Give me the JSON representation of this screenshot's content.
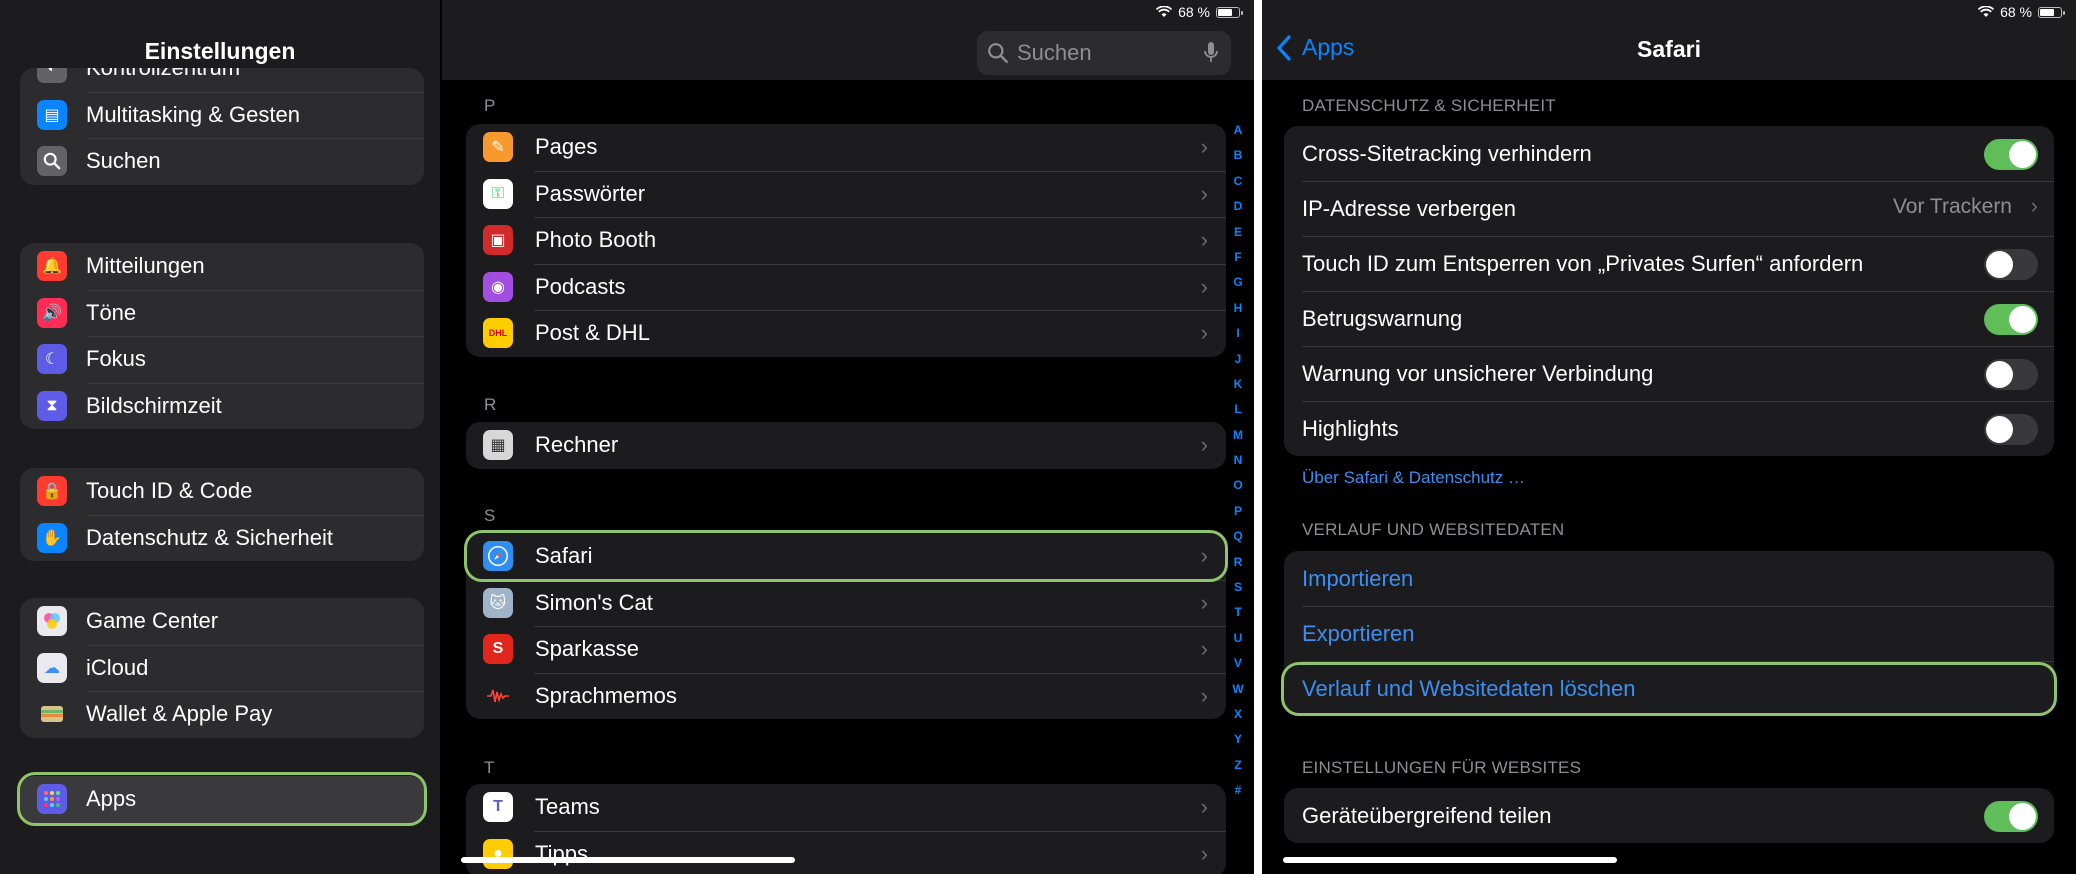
{
  "left": {
    "status": {
      "battery_text": "68 %"
    },
    "sidebar": {
      "title": "Einstellungen",
      "groups": [
        [
          {
            "label": "Kontrollzentrum",
            "icon": "control-center-icon",
            "color": "#636366"
          },
          {
            "label": "Multitasking & Gesten",
            "icon": "multitasking-icon",
            "color": "#0a84ff"
          },
          {
            "label": "Suchen",
            "icon": "search-icon",
            "color": "#636366"
          }
        ],
        [
          {
            "label": "Mitteilungen",
            "icon": "notifications-icon",
            "color": "#ff3b30"
          },
          {
            "label": "Töne",
            "icon": "sounds-icon",
            "color": "#ff2d55"
          },
          {
            "label": "Fokus",
            "icon": "focus-icon",
            "color": "#5e5ce6"
          },
          {
            "label": "Bildschirmzeit",
            "icon": "screen-time-icon",
            "color": "#5e5ce6"
          }
        ],
        [
          {
            "label": "Touch ID & Code",
            "icon": "touch-id-icon",
            "color": "#ff3b30"
          },
          {
            "label": "Datenschutz & Sicherheit",
            "icon": "privacy-hand-icon",
            "color": "#0a84ff"
          }
        ],
        [
          {
            "label": "Game Center",
            "icon": "game-center-icon",
            "color": "#e9e9ef"
          },
          {
            "label": "iCloud",
            "icon": "icloud-icon",
            "color": "#e9e9ef"
          },
          {
            "label": "Wallet & Apple Pay",
            "icon": "wallet-icon",
            "color": "#2c2c2e"
          }
        ],
        [
          {
            "label": "Apps",
            "icon": "apps-grid-icon",
            "color": "#5e5ce6",
            "selected": true
          }
        ]
      ]
    },
    "app_list": {
      "search_placeholder": "Suchen",
      "sections": [
        {
          "letter": "P",
          "items": [
            {
              "label": "Pages",
              "icon": "pages-icon",
              "color": "#f79a2e"
            },
            {
              "label": "Passwörter",
              "icon": "passwords-icon",
              "color": "#ffffff"
            },
            {
              "label": "Photo Booth",
              "icon": "photo-booth-icon",
              "color": "#d12a2a"
            },
            {
              "label": "Podcasts",
              "icon": "podcasts-icon",
              "color": "#a24ee0"
            },
            {
              "label": "Post & DHL",
              "icon": "dhl-icon",
              "color": "#ffcc00"
            }
          ]
        },
        {
          "letter": "R",
          "items": [
            {
              "label": "Rechner",
              "icon": "calculator-icon",
              "color": "#d7d7d7"
            }
          ]
        },
        {
          "letter": "S",
          "items": [
            {
              "label": "Safari",
              "icon": "safari-compass-icon",
              "color": "#2f8ef0",
              "selected": true
            },
            {
              "label": "Simon's Cat",
              "icon": "simons-cat-icon",
              "color": "#9fb4c8"
            },
            {
              "label": "Sparkasse",
              "icon": "sparkasse-icon",
              "color": "#e3261d"
            },
            {
              "label": "Sprachmemos",
              "icon": "voice-memos-icon",
              "color": "#1c1c1e"
            }
          ]
        },
        {
          "letter": "T",
          "items": [
            {
              "label": "Teams",
              "icon": "teams-icon",
              "color": "#ffffff"
            },
            {
              "label": "Tipps",
              "icon": "tips-icon",
              "color": "#ffcc00"
            }
          ]
        }
      ],
      "index_letters": [
        "A",
        "B",
        "C",
        "D",
        "E",
        "F",
        "G",
        "H",
        "I",
        "J",
        "K",
        "L",
        "M",
        "N",
        "O",
        "P",
        "Q",
        "R",
        "S",
        "T",
        "U",
        "V",
        "W",
        "X",
        "Y",
        "Z",
        "#"
      ]
    }
  },
  "right": {
    "status": {
      "battery_text": "68 %"
    },
    "back_label": "Apps",
    "title": "Safari",
    "privacy": {
      "header": "DATENSCHUTZ & SICHERHEIT",
      "rows": [
        {
          "label": "Cross-Sitetracking verhindern",
          "type": "toggle",
          "on": true
        },
        {
          "label": "IP-Adresse verbergen",
          "type": "value",
          "value": "Vor Trackern"
        },
        {
          "label": "Touch ID zum Entsperren von „Privates Surfen“ anfordern",
          "type": "toggle",
          "on": false
        },
        {
          "label": "Betrugswarnung",
          "type": "toggle",
          "on": true
        },
        {
          "label": "Warnung vor unsicherer Verbindung",
          "type": "toggle",
          "on": false
        },
        {
          "label": "Highlights",
          "type": "toggle",
          "on": false
        }
      ],
      "footer_link": "Über Safari & Datenschutz …"
    },
    "history": {
      "header": "VERLAUF UND WEBSITEDATEN",
      "rows": [
        {
          "label": "Importieren"
        },
        {
          "label": "Exportieren"
        },
        {
          "label": "Verlauf und Websitedaten löschen",
          "selected": true
        }
      ]
    },
    "website_settings": {
      "header": "EINSTELLUNGEN FÜR WEBSITES",
      "rows": [
        {
          "label": "Geräteübergreifend teilen",
          "type": "toggle",
          "on": true
        }
      ]
    }
  }
}
